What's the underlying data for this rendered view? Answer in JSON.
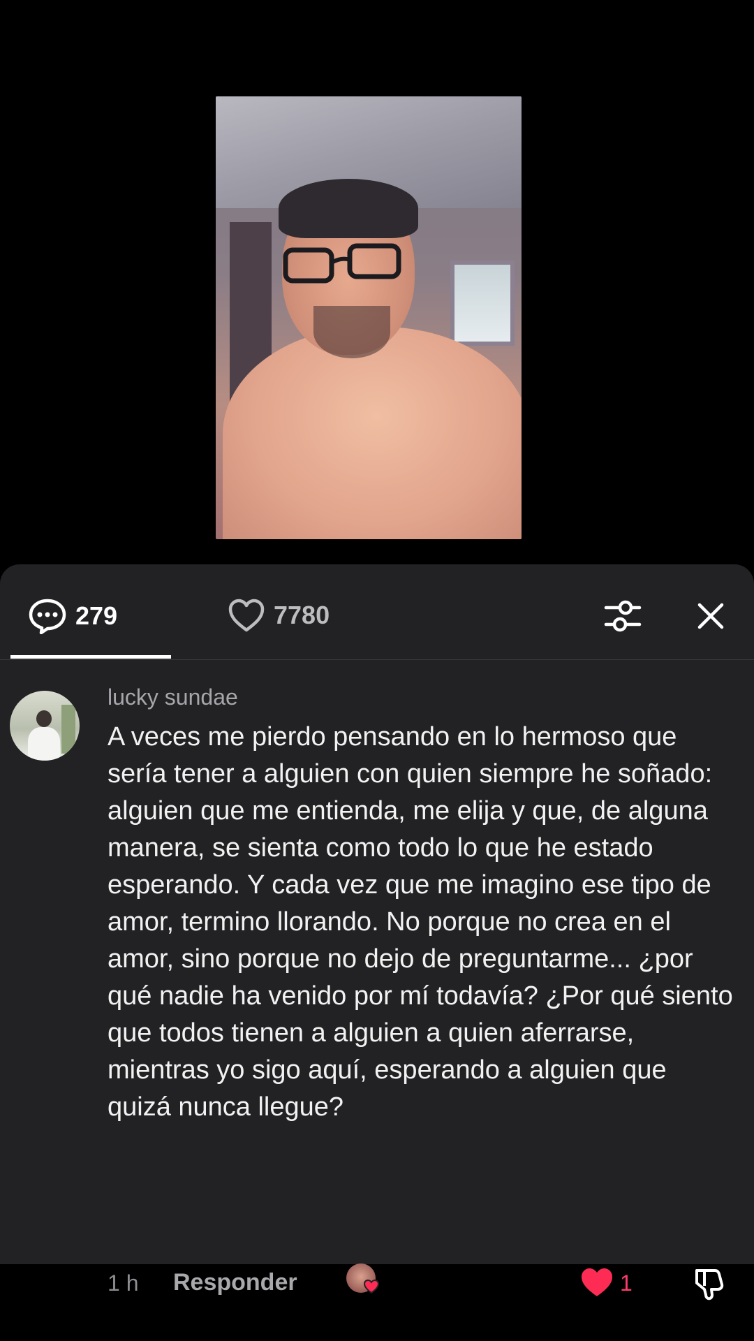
{
  "tabs": {
    "comments_count": "279",
    "likes_count": "7780"
  },
  "comment": {
    "username": "lucky sundae",
    "text": "A veces me pierdo pensando en lo hermoso que sería tener a alguien con quien siempre he soñado: alguien que me entienda, me elija y que, de alguna manera, se sienta como todo lo que he estado esperando. Y cada vez que me imagino ese tipo de amor, termino llorando. No porque no crea en el amor, sino porque no dejo de preguntarme... ¿por qué nadie ha venido por mí todavía? ¿Por qué siento que todos tienen a alguien a quien aferrarse, mientras yo sigo aquí, esperando a alguien que quizá nunca llegue?",
    "time": "1 h",
    "reply_label": "Responder",
    "like_count": "1"
  },
  "colors": {
    "sheet_bg": "#222224",
    "like_red": "#fe2c55"
  },
  "icons": {
    "comments": "speech-bubble-dots-icon",
    "likes": "heart-outline-icon",
    "filter": "sliders-icon",
    "close": "close-icon",
    "like": "heart-filled-icon",
    "dislike": "thumb-down-icon"
  }
}
